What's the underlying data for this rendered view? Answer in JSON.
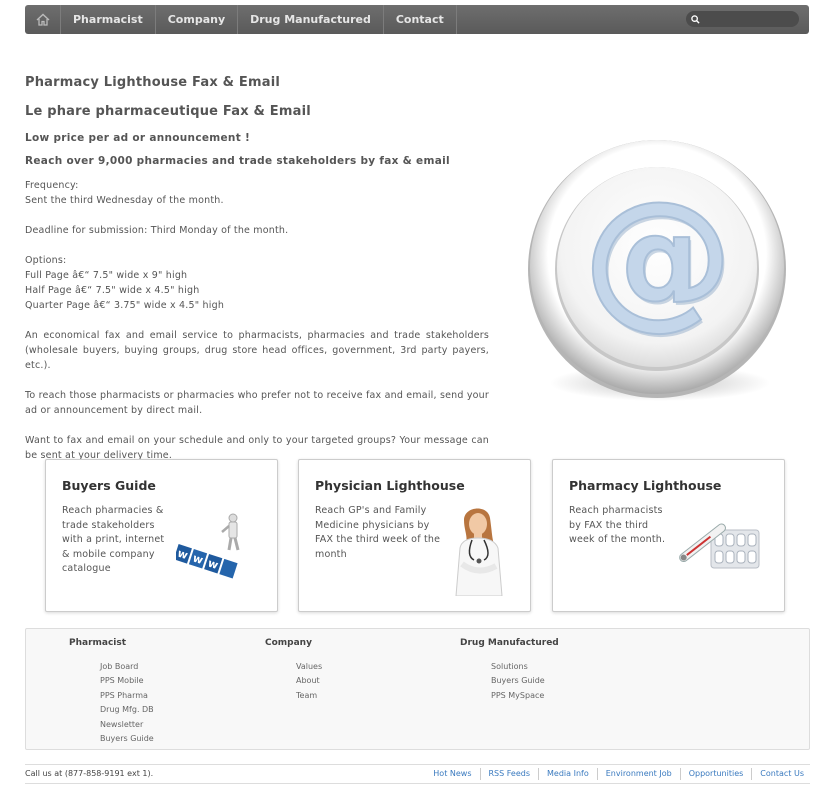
{
  "nav": {
    "items": [
      "Pharmacist",
      "Company",
      "Drug Manufactured",
      "Contact"
    ],
    "search_placeholder": ""
  },
  "main": {
    "title_en": "Pharmacy Lighthouse Fax & Email",
    "title_fr": "Le phare pharmaceutique Fax & Email",
    "tagline1": "Low price per ad or announcement !",
    "tagline2": "Reach over 9,000 pharmacies and trade stakeholders by fax & email",
    "frequency_label": "Frequency:",
    "frequency_value": "Sent the third Wednesday of the month.",
    "deadline": "Deadline for submission: Third Monday of the month.",
    "options_label": "Options:",
    "option_full": "Full Page â€“ 7.5\" wide x 9\" high",
    "option_half": "Half Page â€“ 7.5\" wide x 4.5\" high",
    "option_quarter": "Quarter Page â€“ 3.75\" wide x 4.5\" high",
    "para1": "An economical fax and email service to pharmacists, pharmacies and trade stakeholders (wholesale buyers, buying groups, drug store head offices, government, 3rd party payers, etc.).",
    "para2": "To reach those pharmacists or pharmacies who prefer not to receive fax and email, send your ad or announcement by direct mail.",
    "para3": "Want to fax and email on your schedule and only to your targeted groups? Your message can be sent at your delivery time."
  },
  "cards": [
    {
      "title": "Buyers Guide",
      "text": "Reach pharmacies & trade stakeholders with a print, internet & mobile company catalogue",
      "image_icon": "www-figure-icon"
    },
    {
      "title": "Physician Lighthouse",
      "text": "Reach GP's and Family Medicine physicians by FAX the third week of the month",
      "image_icon": "doctor-icon"
    },
    {
      "title": "Pharmacy Lighthouse",
      "text": "Reach pharmacists by FAX the third week of the month.",
      "image_icon": "thermometer-pills-icon"
    }
  ],
  "footer": {
    "columns": [
      {
        "heading": "Pharmacist",
        "links": [
          "Job Board",
          "PPS Mobile",
          "PPS Pharma",
          "Drug Mfg. DB",
          "Newsletter",
          "Buyers Guide"
        ]
      },
      {
        "heading": "Company",
        "links": [
          "Values",
          "About",
          "Team"
        ]
      },
      {
        "heading": "Drug Manufactured",
        "links": [
          "Solutions",
          "Buyers Guide",
          "PPS MySpace"
        ]
      }
    ]
  },
  "bottom": {
    "call": "Call us at (877-858-9191 ext 1).",
    "links": [
      "Hot News",
      "RSS Feeds",
      "Media Info",
      "Environment Job",
      "Opportunities",
      "Contact Us"
    ]
  },
  "colors": {
    "nav_bg": "#636363",
    "link": "#3a7abf",
    "at_symbol": "#b9cde3"
  }
}
